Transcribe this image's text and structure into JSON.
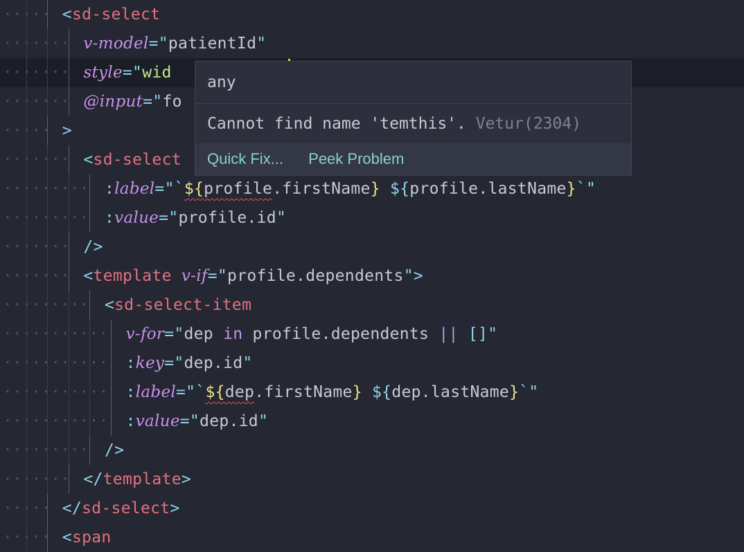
{
  "editor": {
    "lines": [
      [
        {
          "t": "<",
          "c": "punct"
        },
        {
          "t": "sd-select",
          "c": "tag"
        }
      ],
      [
        {
          "t": "v-model",
          "c": "attr"
        },
        {
          "t": "=\"",
          "c": "punct"
        },
        {
          "t": "patientId",
          "c": "str"
        },
        {
          "t": "\"",
          "c": "punct"
        }
      ],
      [
        {
          "t": "style",
          "c": "attr"
        },
        {
          "t": "=\"",
          "c": "punct"
        },
        {
          "t": "wid",
          "c": "strg"
        }
      ],
      [
        {
          "t": "@input",
          "c": "attr"
        },
        {
          "t": "=\"",
          "c": "punct"
        },
        {
          "t": "fo",
          "c": "str"
        }
      ],
      [
        {
          "t": ">",
          "c": "punct"
        }
      ],
      [
        {
          "t": "<",
          "c": "punct"
        },
        {
          "t": "sd-select",
          "c": "tag"
        }
      ],
      [
        {
          "t": ":",
          "c": "punct"
        },
        {
          "t": "label",
          "c": "attr"
        },
        {
          "t": "=\"",
          "c": "punct"
        },
        {
          "t": "`",
          "c": "punct"
        },
        {
          "t": "${",
          "c": "brace",
          "sq": true
        },
        {
          "t": "profile",
          "c": "plain",
          "sq": true
        },
        {
          "t": ".firstName",
          "c": "plain"
        },
        {
          "t": "}",
          "c": "brace"
        },
        {
          "t": " ",
          "c": "plain"
        },
        {
          "t": "${",
          "c": "punct"
        },
        {
          "t": "profile.lastName",
          "c": "plain"
        },
        {
          "t": "}",
          "c": "brace"
        },
        {
          "t": "`\"",
          "c": "punct"
        }
      ],
      [
        {
          "t": ":",
          "c": "punct"
        },
        {
          "t": "value",
          "c": "attr"
        },
        {
          "t": "=\"",
          "c": "punct"
        },
        {
          "t": "profile.id",
          "c": "str"
        },
        {
          "t": "\"",
          "c": "punct"
        }
      ],
      [
        {
          "t": "/>",
          "c": "punct"
        }
      ],
      [
        {
          "t": "<",
          "c": "punct"
        },
        {
          "t": "template",
          "c": "tag"
        },
        {
          "t": " ",
          "c": "plain"
        },
        {
          "t": "v-if",
          "c": "attr"
        },
        {
          "t": "=\"",
          "c": "punct"
        },
        {
          "t": "profile.dependents",
          "c": "str"
        },
        {
          "t": "\">",
          "c": "punct"
        }
      ],
      [
        {
          "t": "<",
          "c": "punct"
        },
        {
          "t": "sd-select-item",
          "c": "tag"
        }
      ],
      [
        {
          "t": "v-for",
          "c": "attr"
        },
        {
          "t": "=\"",
          "c": "punct"
        },
        {
          "t": "dep ",
          "c": "plain"
        },
        {
          "t": "in",
          "c": "op"
        },
        {
          "t": " profile.dependents ",
          "c": "plain"
        },
        {
          "t": "||",
          "c": "op"
        },
        {
          "t": " ",
          "c": "plain"
        },
        {
          "t": "[]",
          "c": "punct"
        },
        {
          "t": "\"",
          "c": "punct"
        }
      ],
      [
        {
          "t": ":",
          "c": "punct"
        },
        {
          "t": "key",
          "c": "attr"
        },
        {
          "t": "=\"",
          "c": "punct"
        },
        {
          "t": "dep.id",
          "c": "str"
        },
        {
          "t": "\"",
          "c": "punct"
        }
      ],
      [
        {
          "t": ":",
          "c": "punct"
        },
        {
          "t": "label",
          "c": "attr"
        },
        {
          "t": "=\"",
          "c": "punct"
        },
        {
          "t": "`",
          "c": "punct"
        },
        {
          "t": "${",
          "c": "brace",
          "sq": true
        },
        {
          "t": "dep",
          "c": "plain",
          "sq": true
        },
        {
          "t": ".firstName",
          "c": "plain"
        },
        {
          "t": "}",
          "c": "brace"
        },
        {
          "t": " ",
          "c": "plain"
        },
        {
          "t": "${",
          "c": "punct"
        },
        {
          "t": "dep.lastName",
          "c": "plain"
        },
        {
          "t": "}",
          "c": "brace"
        },
        {
          "t": "`\"",
          "c": "punct"
        }
      ],
      [
        {
          "t": ":",
          "c": "punct"
        },
        {
          "t": "value",
          "c": "attr"
        },
        {
          "t": "=\"",
          "c": "punct"
        },
        {
          "t": "dep.id",
          "c": "str"
        },
        {
          "t": "\"",
          "c": "punct"
        }
      ],
      [
        {
          "t": "/>",
          "c": "punct"
        }
      ],
      [
        {
          "t": "</",
          "c": "punct"
        },
        {
          "t": "template",
          "c": "tag"
        },
        {
          "t": ">",
          "c": "punct"
        }
      ],
      [
        {
          "t": "</",
          "c": "punct"
        },
        {
          "t": "sd-select",
          "c": "tag"
        },
        {
          "t": ">",
          "c": "punct"
        }
      ],
      [
        {
          "t": "<",
          "c": "punct"
        },
        {
          "t": "span",
          "c": "tag"
        }
      ]
    ],
    "indent_levels": [
      3,
      4,
      4,
      4,
      3,
      4,
      5,
      5,
      4,
      4,
      5,
      6,
      6,
      6,
      6,
      5,
      4,
      3,
      3
    ],
    "active_line": 2
  },
  "hover": {
    "type_text": "any",
    "message": "Cannot find name 'temthis'.",
    "source": "Vetur(2304)",
    "actions": [
      "Quick Fix...",
      "Peek Problem"
    ]
  },
  "colors": {
    "background": "#252733",
    "tag": "#e1727d",
    "attribute": "#c792ea",
    "punctuation": "#8fd3ea",
    "string": "#c7cad6",
    "error_squiggle": "#e0565f",
    "action_link": "#89d3c2"
  }
}
